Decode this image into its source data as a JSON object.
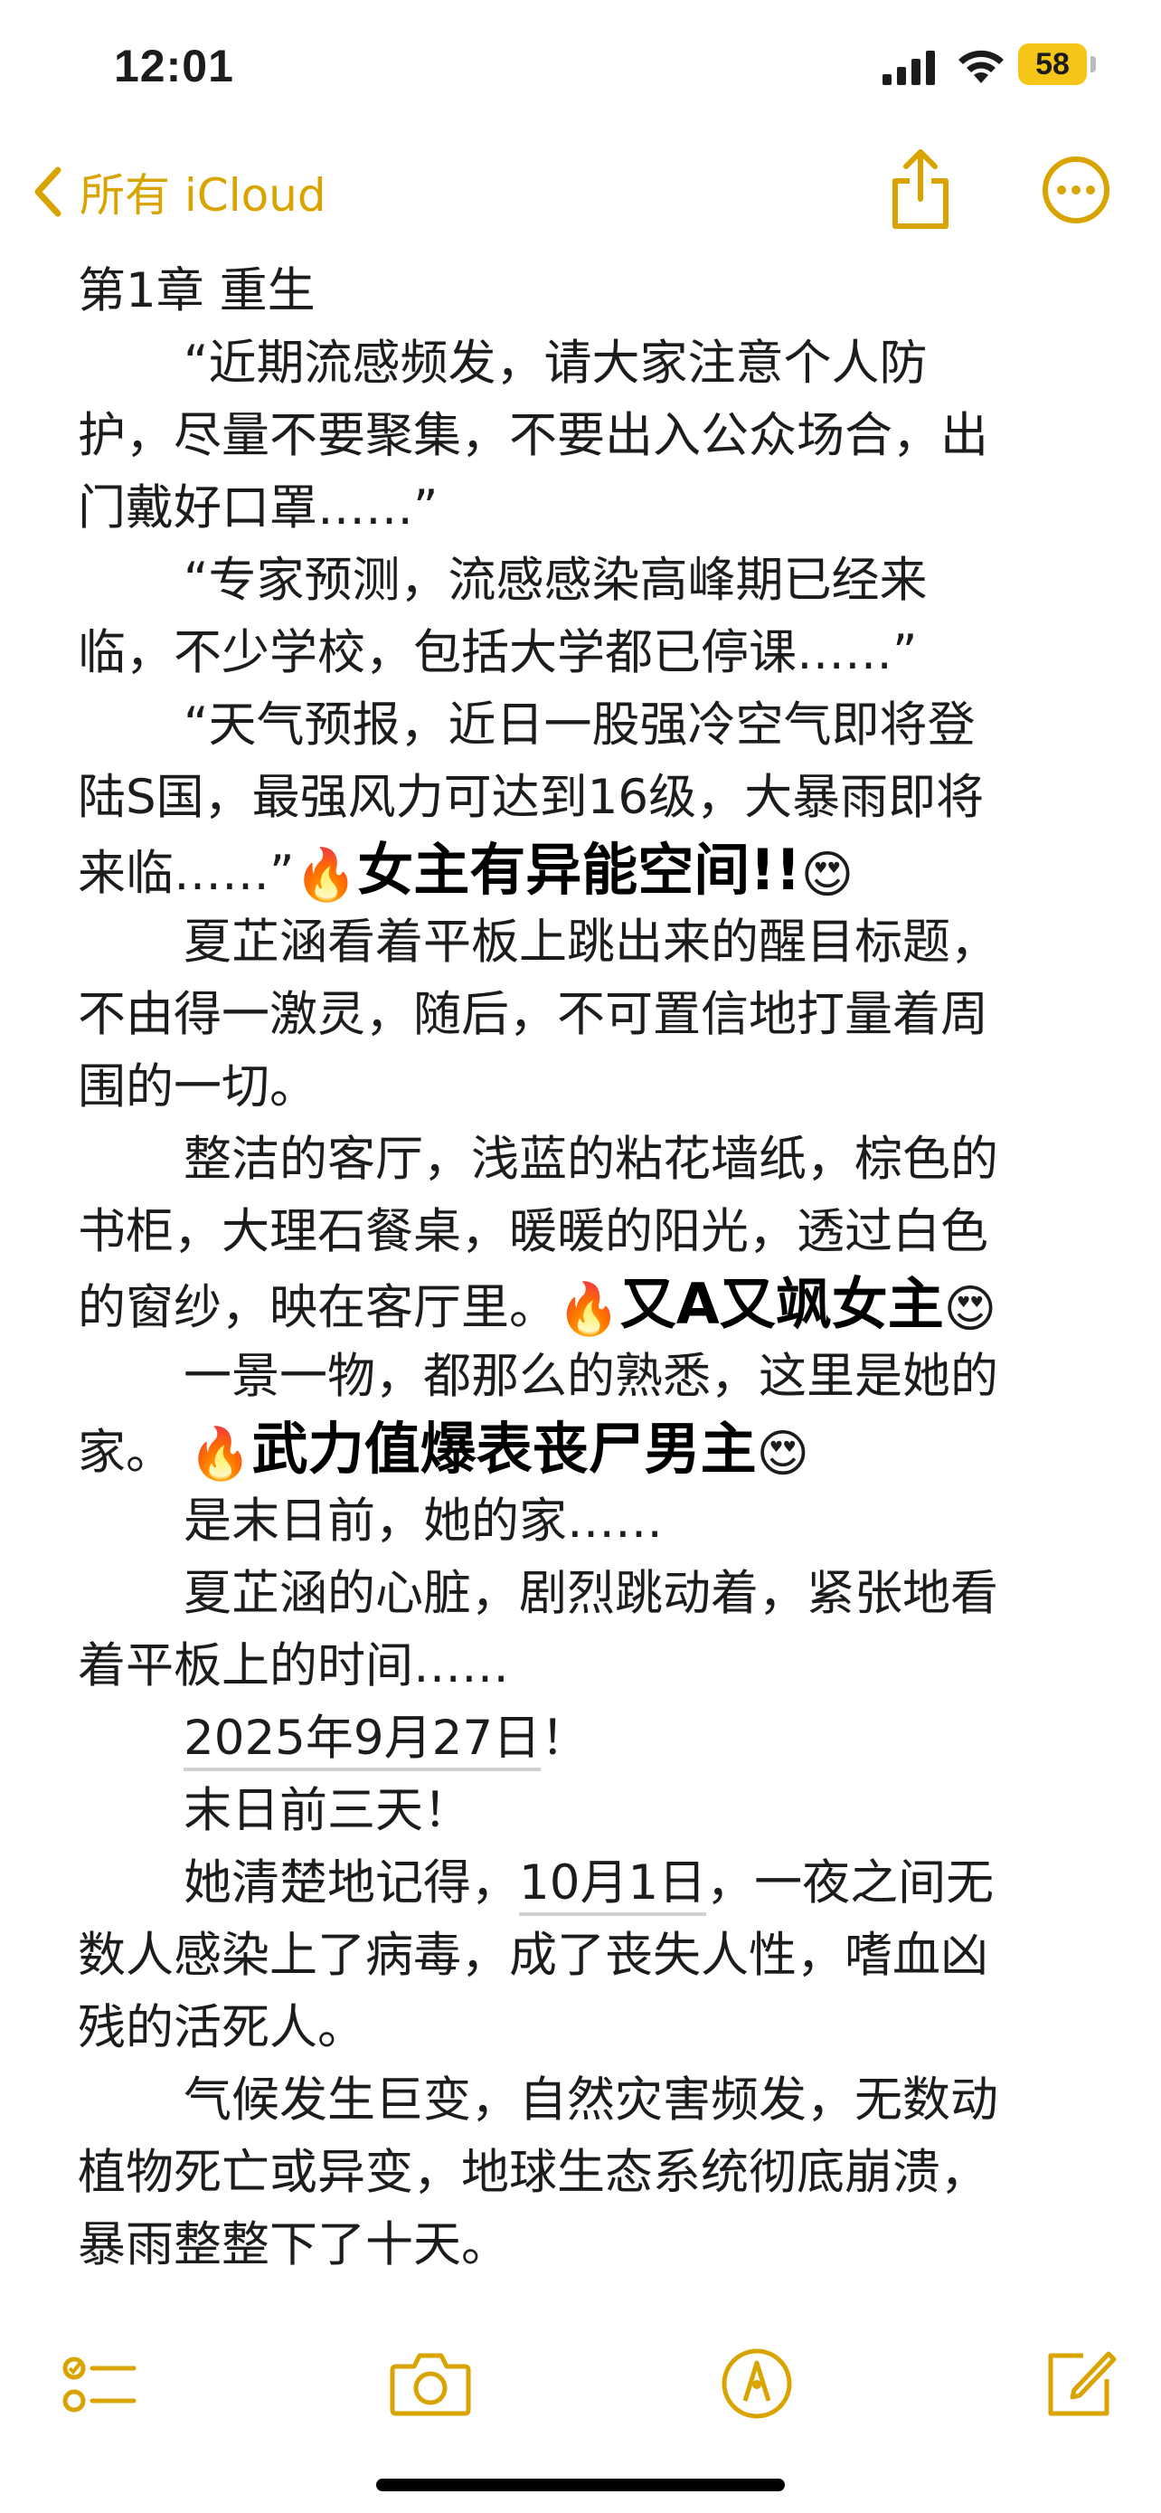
{
  "status_bar": {
    "time": "12:01",
    "battery_level": "58",
    "battery_color": "#f5c518"
  },
  "nav": {
    "back_label": "所有 iCloud",
    "accent_color": "#d9a300",
    "back_icon": "chevron-left-icon",
    "share_icon": "share-icon",
    "more_icon": "more-icon"
  },
  "note": {
    "lines": [
      {
        "text": "第1章  重生"
      },
      {
        "text": "“近期流感频发，请大家注意个人防",
        "indent": true
      },
      {
        "text": "护，尽量不要聚集，不要出入公众场合，出"
      },
      {
        "text": "门戴好口罩……”"
      },
      {
        "text": "“专家预测，流感感染高峰期已经来",
        "indent": true
      },
      {
        "text": "临，不少学校，包括大学都已停课……”"
      },
      {
        "text": "“天气预报，近日一股强冷空气即将登",
        "indent": true
      },
      {
        "text": "陆S国，最强风力可达到16级，大暴雨即将"
      },
      {
        "text": "来临……”",
        "overlay": "女主有异能空间!!"
      },
      {
        "text": "夏芷涵看着平板上跳出来的醒目标题，",
        "indent": true
      },
      {
        "text": "不由得一激灵，随后，不可置信地打量着周"
      },
      {
        "text": "围的一切。"
      },
      {
        "text": "整洁的客厅，浅蓝的粘花墙纸，棕色的",
        "indent": true
      },
      {
        "text": "书柜，大理石餐桌，暖暖的阳光，透过白色"
      },
      {
        "text": "的窗纱，映在客厅里。",
        "overlay": "又A又飒女主"
      },
      {
        "text": "一景一物，都那么的熟悉，这里是她的",
        "indent": true
      },
      {
        "text": "家。 ",
        "overlay": "武力值爆表丧尸男主"
      },
      {
        "text": "是末日前，她的家……",
        "indent": true
      },
      {
        "text": "夏芷涵的心脏，剧烈跳动着，紧张地看",
        "indent": true
      },
      {
        "text": "着平板上的时间……"
      },
      {
        "text": "2025年9月27日",
        "indent": true,
        "underline": true,
        "suffix": "！"
      },
      {
        "text": "末日前三天！",
        "indent": true
      },
      {
        "text": "她清楚地记得，",
        "indent": true,
        "underline_part": "10月1日",
        "suffix": "，一夜之间无"
      },
      {
        "text": "数人感染上了病毒，成了丧失人性，嗜血凶"
      },
      {
        "text": "残的活死人。"
      },
      {
        "text": "气候发生巨变，自然灾害频发，无数动",
        "indent": true
      },
      {
        "text": "植物死亡或异变，地球生态系统彻底崩溃，"
      },
      {
        "text": "暴雨整整下了十天。"
      }
    ],
    "emoji_fire": "🔥",
    "emoji_heart_eyes": "😍"
  },
  "toolbar": {
    "checklist_icon": "checklist-icon",
    "camera_icon": "camera-icon",
    "markup_icon": "markup-icon",
    "compose_icon": "compose-icon"
  }
}
